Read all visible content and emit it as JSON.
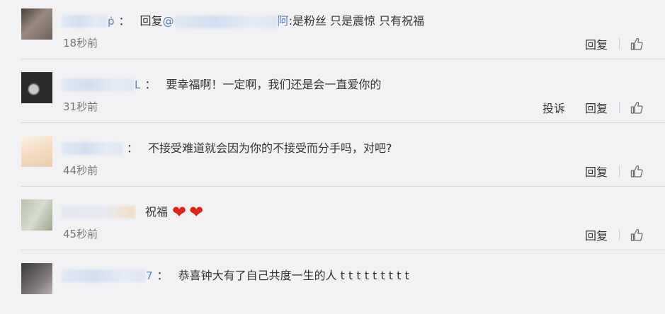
{
  "comments": [
    {
      "username_tail": "ṗ",
      "mention_prefix": "@",
      "mention_tail": "阿",
      "reply_label": "回复",
      "text": ":是粉丝 只是震惊 只有祝福",
      "time": "18秒前",
      "actions": [
        "回复"
      ]
    },
    {
      "username_tail": "L",
      "text": "要幸福啊！一定啊，我们还是会一直爱你的",
      "time": "31秒前",
      "actions": [
        "投诉",
        "回复"
      ]
    },
    {
      "username_tail": "",
      "text": "不接受难道就会因为你的不接受而分手吗，对吧?",
      "time": "44秒前",
      "actions": [
        "回复"
      ]
    },
    {
      "username_tail": "",
      "text": "祝福",
      "hearts": [
        "❤",
        "❤"
      ],
      "time": "45秒前",
      "actions": [
        "回复"
      ]
    },
    {
      "username_tail": "7",
      "text": "恭喜钟大有了自己共度一生的人 t t t t t t t t t",
      "time": "",
      "actions": []
    }
  ],
  "separator": "：",
  "icons": {
    "like": "thumbs-up-icon"
  },
  "colors": {
    "background": "#f2f2f5",
    "link": "#5b7fb6",
    "meta": "#777777",
    "heart": "#e2231a"
  }
}
